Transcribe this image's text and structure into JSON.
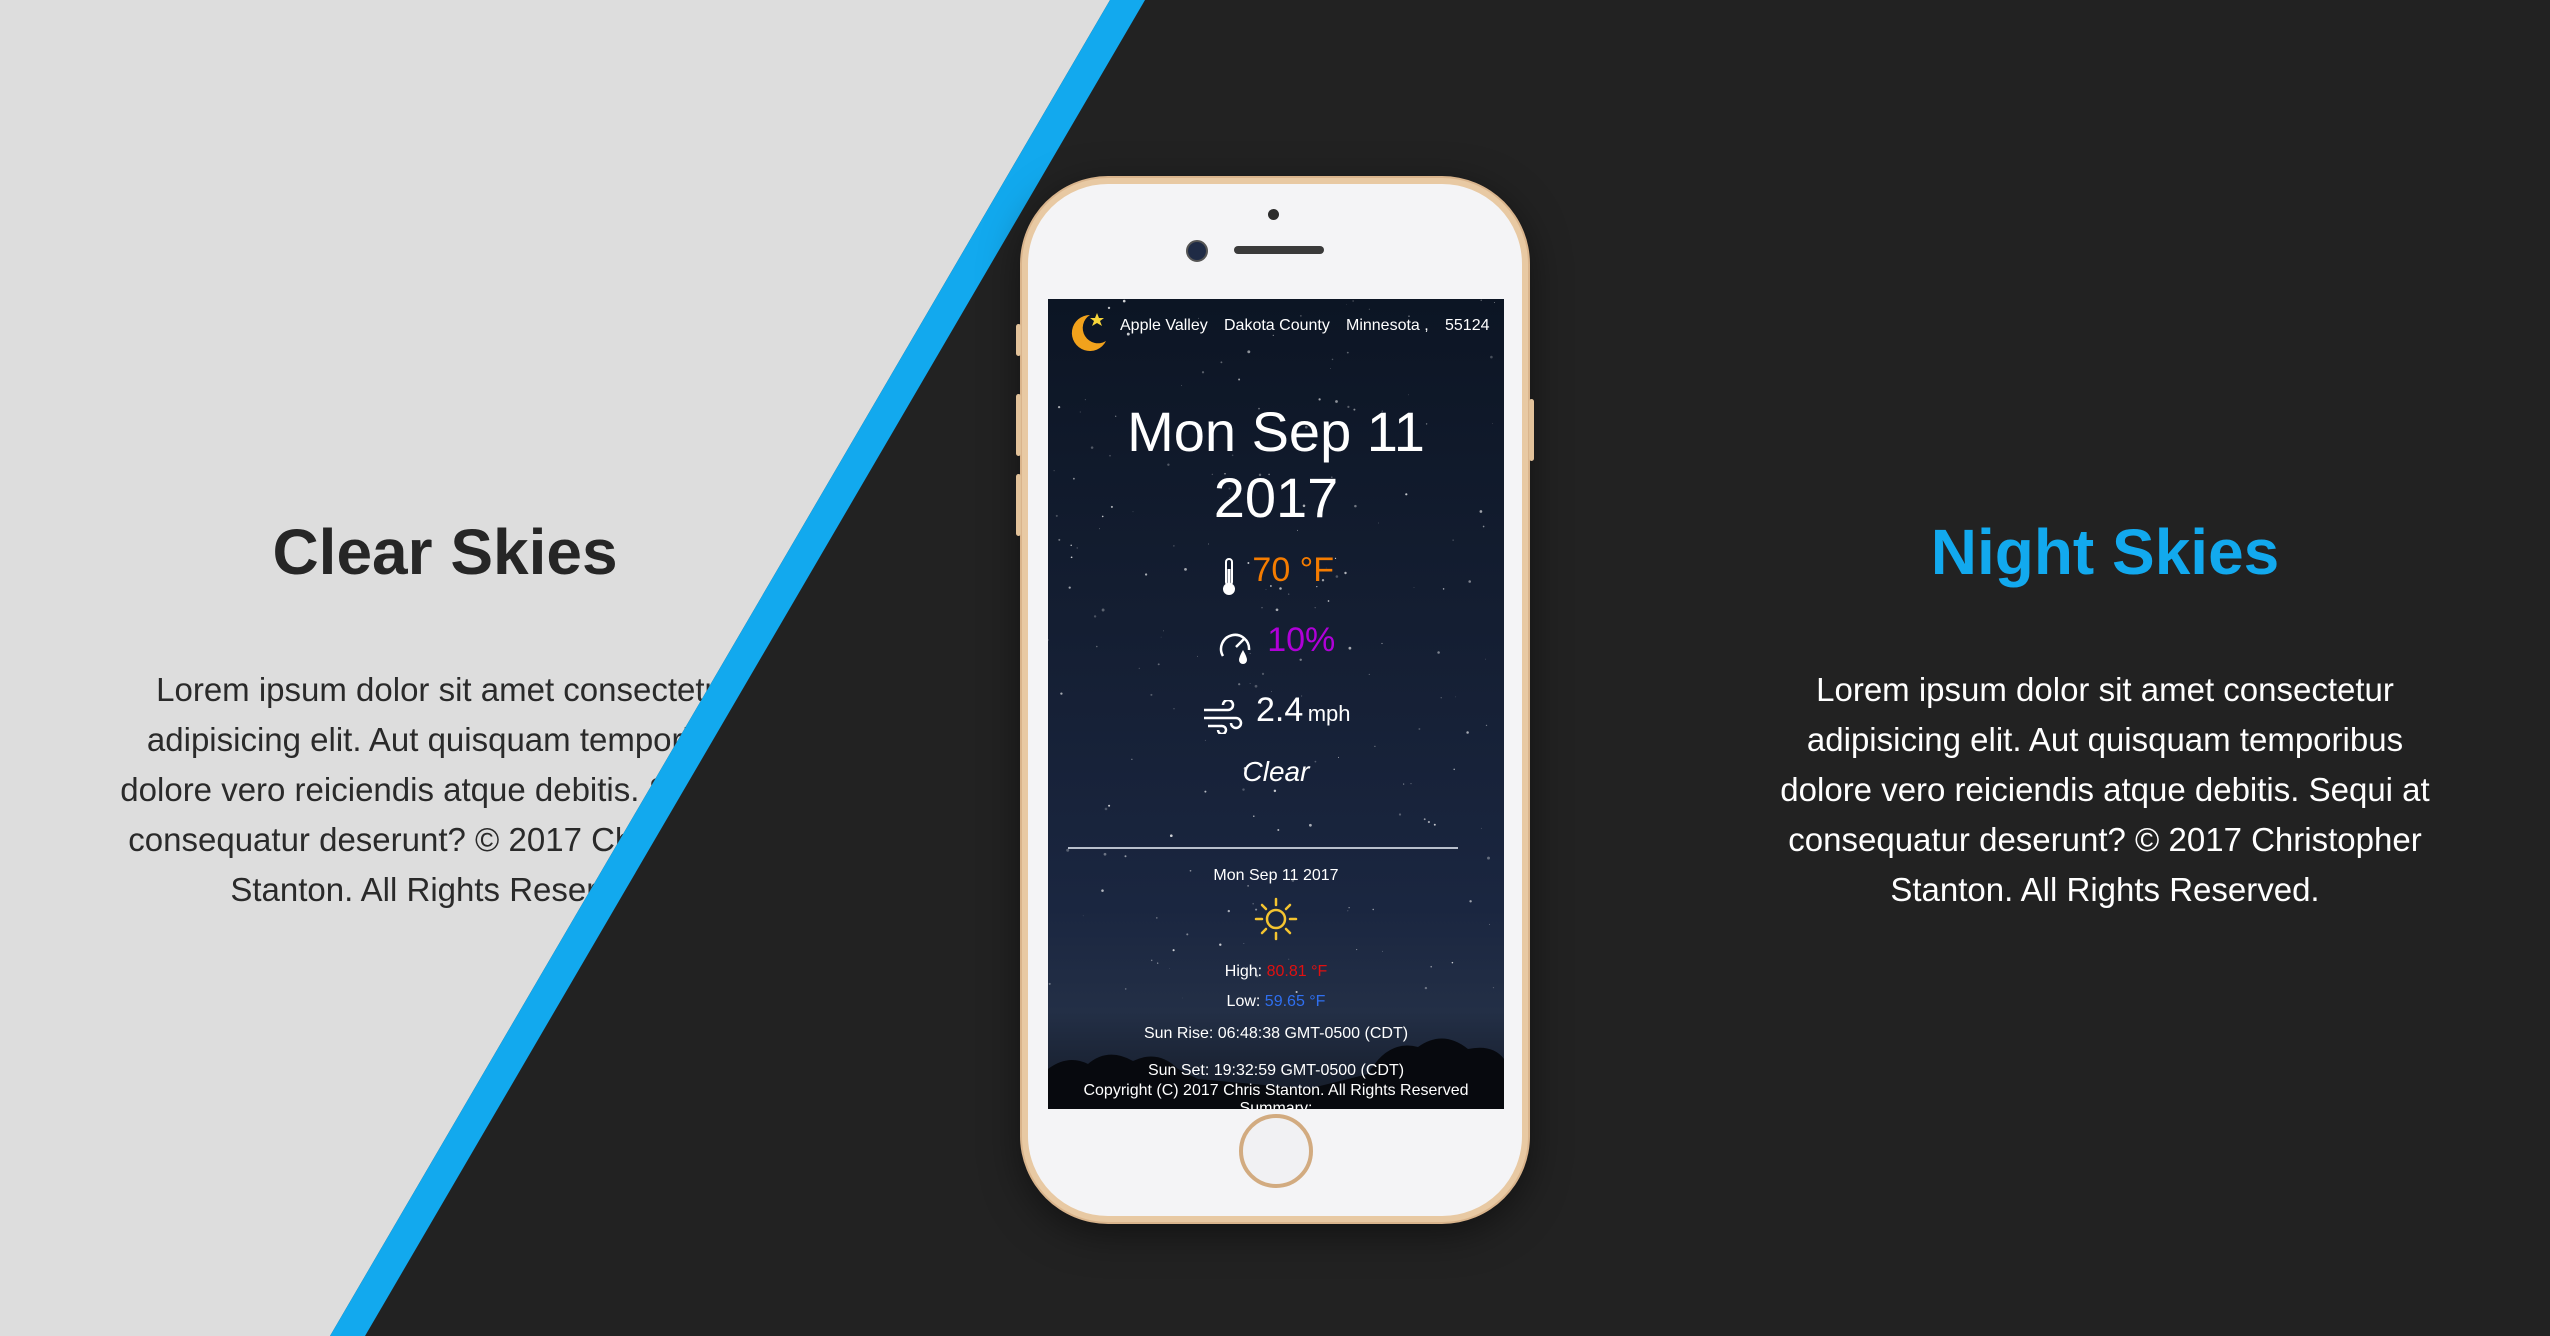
{
  "left_panel": {
    "title": "Clear Skies",
    "body": "Lorem ipsum dolor sit amet consectetur adipisicing elit. Aut quisquam temporibus dolore vero reiciendis atque debitis. Sequi at consequatur deserunt? © 2017 Christopher Stanton. All Rights Reserved."
  },
  "right_panel": {
    "title": "Night Skies",
    "body": "Lorem ipsum dolor sit amet consectetur adipisicing elit. Aut quisquam temporibus dolore vero reiciendis atque debitis. Sequi at consequatur deserunt? © 2017 Christopher Stanton. All Rights Reserved."
  },
  "colors": {
    "accent": "#12a9ee",
    "light_bg": "#dddddd",
    "dark_bg": "#222222",
    "temp": "#f57c00",
    "humidity": "#b000d8",
    "high": "#e01010",
    "low": "#2f6ff0"
  },
  "app": {
    "location": {
      "city": "Apple Valley",
      "county": "Dakota County",
      "state": "Minnesota ,",
      "zip": "55124"
    },
    "date_line1": "Mon Sep 11",
    "date_line2": "2017",
    "temperature": "70 °F",
    "humidity": "10%",
    "wind_value": "2.4",
    "wind_unit": "mph",
    "condition": "Clear",
    "forecast": {
      "date": "Mon Sep 11 2017",
      "high_label": "High:",
      "high_value": "80.81 °F",
      "low_label": "Low:",
      "low_value": "59.65 °F",
      "sunrise": "Sun Rise: 06:48:38 GMT-0500 (CDT)",
      "sunset": "Sun Set: 19:32:59 GMT-0500 (CDT)",
      "copyright": "Copyright (C) 2017 Chris Stanton. All Rights Reserved",
      "summary": "Summary:"
    },
    "icons": [
      "moon-icon",
      "thermometer-icon",
      "humidity-gauge-icon",
      "wind-icon",
      "sun-icon"
    ]
  }
}
